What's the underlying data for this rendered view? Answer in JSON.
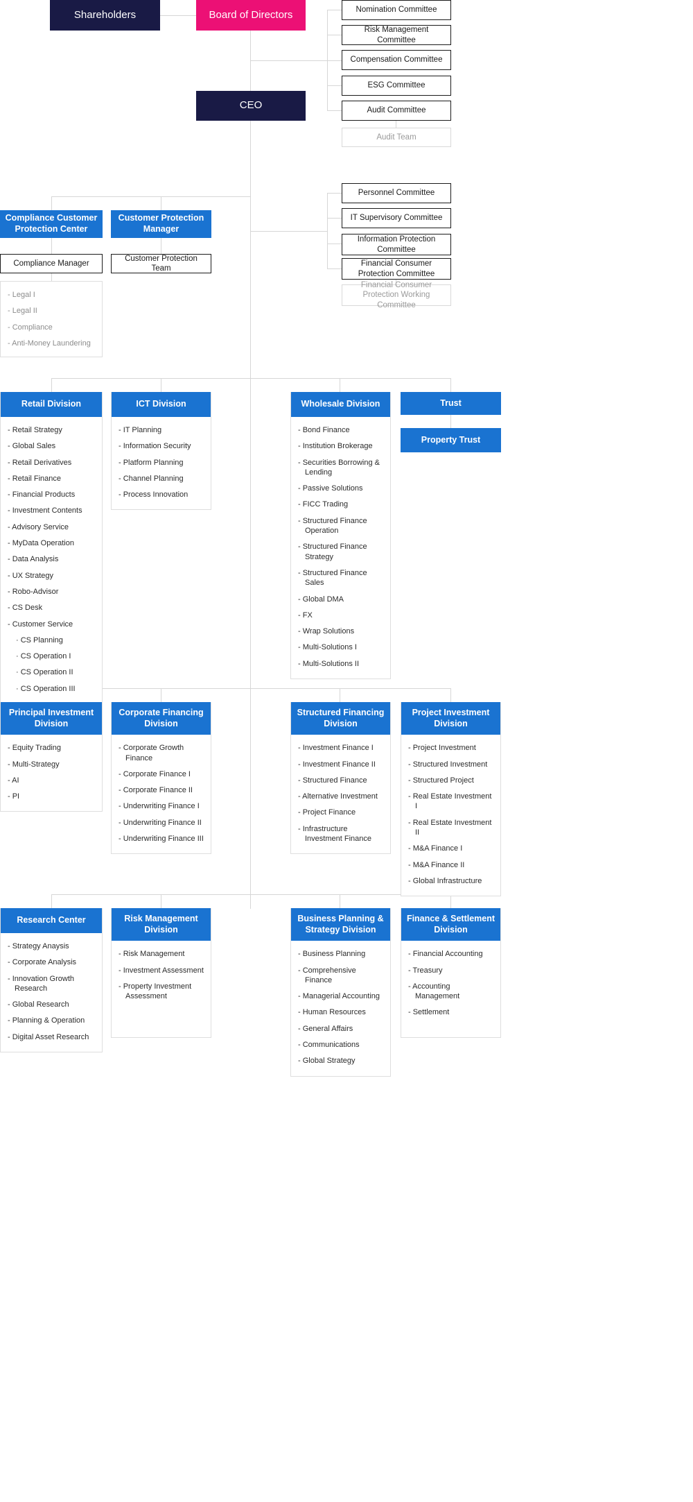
{
  "colors": {
    "navy": "#191a45",
    "pink": "#ec1075",
    "blue": "#1a73d1",
    "line": "#d6d6d6",
    "ghost_text": "#9a9a9a"
  },
  "top": {
    "shareholders": "Shareholders",
    "board_of_directors": "Board of Directors",
    "ceo": "CEO"
  },
  "board_committees": [
    "Nomination Committee",
    "Risk Management Committee",
    "Compensation Committee",
    "ESG Committee",
    "Audit Committee"
  ],
  "audit_team": "Audit Team",
  "ceo_committees": [
    "Personnel Committee",
    "IT Supervisory Committee",
    "Information Protection Committee",
    "Financial Consumer Protection Committee"
  ],
  "fcp_working_committee": "Financial Consumer Protection Working Committee",
  "compliance": {
    "center": "Compliance Customer Protection Center",
    "manager": "Compliance Manager",
    "items": [
      "- Legal I",
      "- Legal II",
      "- Compliance",
      "- Anti-Money Laundering"
    ]
  },
  "customer_protection": {
    "manager": "Customer Protection Manager",
    "team": "Customer Protection Team"
  },
  "divisions": {
    "retail": {
      "title": "Retail Division",
      "items": [
        {
          "text": "- Retail Strategy",
          "sub": false
        },
        {
          "text": "- Global Sales",
          "sub": false
        },
        {
          "text": "- Retail Derivatives",
          "sub": false
        },
        {
          "text": "- Retail Finance",
          "sub": false
        },
        {
          "text": "- Financial Products",
          "sub": false
        },
        {
          "text": "- Investment Contents",
          "sub": false
        },
        {
          "text": "- Advisory Service",
          "sub": false
        },
        {
          "text": "- MyData Operation",
          "sub": false
        },
        {
          "text": "- Data Analysis",
          "sub": false
        },
        {
          "text": "- UX Strategy",
          "sub": false
        },
        {
          "text": "- Robo-Advisor",
          "sub": false
        },
        {
          "text": "- CS Desk",
          "sub": false
        },
        {
          "text": "- Customer Service",
          "sub": false
        },
        {
          "text": "· CS Planning",
          "sub": true
        },
        {
          "text": "· CS Operation I",
          "sub": true
        },
        {
          "text": "· CS Operation II",
          "sub": true
        },
        {
          "text": "· CS Operation III",
          "sub": true
        }
      ]
    },
    "ict": {
      "title": "ICT Division",
      "items": [
        {
          "text": "- IT Planning",
          "sub": false
        },
        {
          "text": "- Information Security",
          "sub": false
        },
        {
          "text": "- Platform Planning",
          "sub": false
        },
        {
          "text": "- Channel Planning",
          "sub": false
        },
        {
          "text": "- Process Innovation",
          "sub": false
        }
      ]
    },
    "wholesale": {
      "title": "Wholesale Division",
      "items": [
        {
          "text": "- Bond Finance",
          "sub": false
        },
        {
          "text": "- Institution Brokerage",
          "sub": false
        },
        {
          "text": "- Securities Borrowing & Lending",
          "sub": false
        },
        {
          "text": "- Passive Solutions",
          "sub": false
        },
        {
          "text": "- FICC Trading",
          "sub": false
        },
        {
          "text": "- Structured Finance Operation",
          "sub": false
        },
        {
          "text": "- Structured Finance Strategy",
          "sub": false
        },
        {
          "text": "- Structured Finance Sales",
          "sub": false
        },
        {
          "text": "- Global DMA",
          "sub": false
        },
        {
          "text": "- FX",
          "sub": false
        },
        {
          "text": "- Wrap Solutions",
          "sub": false
        },
        {
          "text": "- Multi-Solutions I",
          "sub": false
        },
        {
          "text": "- Multi-Solutions II",
          "sub": false
        }
      ]
    },
    "trust": {
      "title": "Trust",
      "property_trust": "Property Trust"
    },
    "principal_investment": {
      "title": "Principal Investment Division",
      "items": [
        {
          "text": "- Equity Trading",
          "sub": false
        },
        {
          "text": "- Multi-Strategy",
          "sub": false
        },
        {
          "text": "- AI",
          "sub": false
        },
        {
          "text": "- PI",
          "sub": false
        }
      ]
    },
    "corporate_financing": {
      "title": "Corporate Financing Division",
      "items": [
        {
          "text": "- Corporate Growth Finance",
          "sub": false
        },
        {
          "text": "- Corporate Finance I",
          "sub": false
        },
        {
          "text": "- Corporate Finance II",
          "sub": false
        },
        {
          "text": "- Underwriting Finance I",
          "sub": false
        },
        {
          "text": "- Underwriting Finance II",
          "sub": false
        },
        {
          "text": "- Underwriting Finance III",
          "sub": false
        }
      ]
    },
    "structured_financing": {
      "title": "Structured Financing Division",
      "items": [
        {
          "text": "- Investment Finance I",
          "sub": false
        },
        {
          "text": "- Investment Finance II",
          "sub": false
        },
        {
          "text": "- Structured Finance",
          "sub": false
        },
        {
          "text": "- Alternative Investment",
          "sub": false
        },
        {
          "text": "- Project Finance",
          "sub": false
        },
        {
          "text": "- Infrastructure Investment Finance",
          "sub": false
        }
      ]
    },
    "project_investment": {
      "title": "Project Investment Division",
      "items": [
        {
          "text": "- Project Investment",
          "sub": false
        },
        {
          "text": "- Structured Investment",
          "sub": false
        },
        {
          "text": "- Structured Project",
          "sub": false
        },
        {
          "text": "- Real Estate Investment I",
          "sub": false
        },
        {
          "text": "- Real Estate Investment II",
          "sub": false
        },
        {
          "text": "- M&A Finance I",
          "sub": false
        },
        {
          "text": "- M&A Finance II",
          "sub": false
        },
        {
          "text": "- Global Infrastructure",
          "sub": false
        }
      ]
    },
    "research_center": {
      "title": "Research Center",
      "items": [
        {
          "text": "- Strategy Anaysis",
          "sub": false
        },
        {
          "text": "- Corporate Analysis",
          "sub": false
        },
        {
          "text": "- Innovation Growth Research",
          "sub": false
        },
        {
          "text": "- Global Research",
          "sub": false
        },
        {
          "text": "- Planning & Operation",
          "sub": false
        },
        {
          "text": "- Digital Asset Research",
          "sub": false
        }
      ]
    },
    "risk_management": {
      "title": "Risk Management Division",
      "items": [
        {
          "text": "- Risk Management",
          "sub": false
        },
        {
          "text": "- Investment Assessment",
          "sub": false
        },
        {
          "text": "- Property Investment Assessment",
          "sub": false
        }
      ]
    },
    "business_planning": {
      "title": "Business Planning & Strategy Division",
      "items": [
        {
          "text": "- Business Planning",
          "sub": false
        },
        {
          "text": "- Comprehensive Finance",
          "sub": false
        },
        {
          "text": "- Managerial Accounting",
          "sub": false
        },
        {
          "text": "- Human Resources",
          "sub": false
        },
        {
          "text": "- General Affairs",
          "sub": false
        },
        {
          "text": "- Communications",
          "sub": false
        },
        {
          "text": "- Global Strategy",
          "sub": false
        }
      ]
    },
    "finance_settlement": {
      "title": "Finance & Settlement Division",
      "items": [
        {
          "text": "- Financial Accounting",
          "sub": false
        },
        {
          "text": "- Treasury",
          "sub": false
        },
        {
          "text": "- Accounting Management",
          "sub": false
        },
        {
          "text": "- Settlement",
          "sub": false
        }
      ]
    }
  }
}
